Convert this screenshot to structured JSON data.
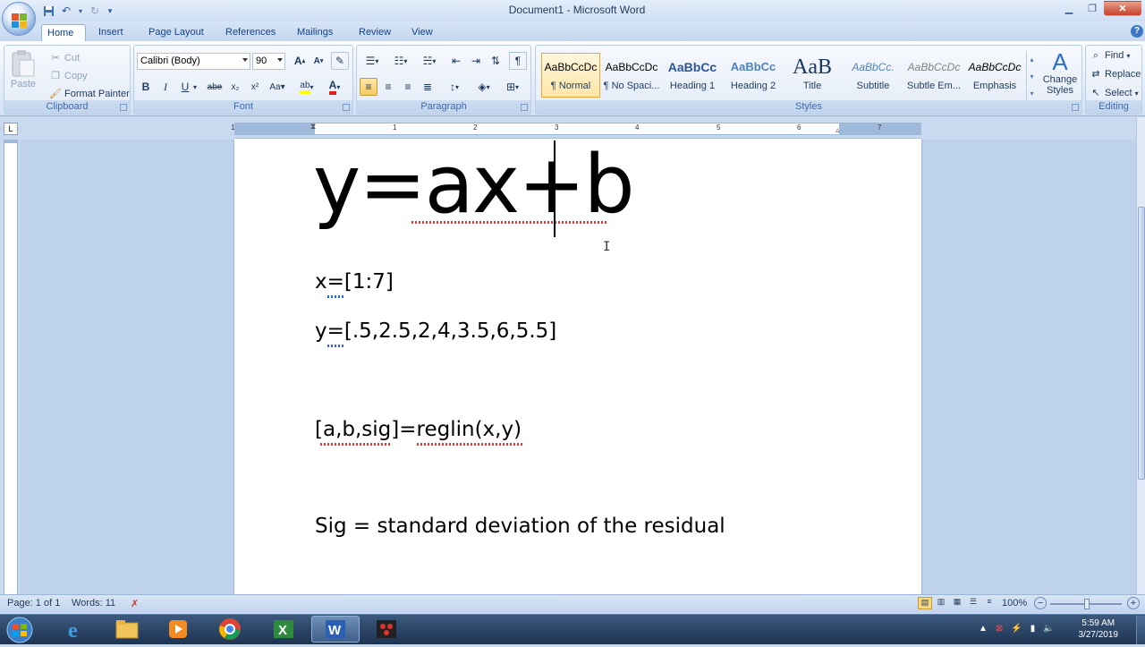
{
  "window": {
    "title": "Document1 - Microsoft Word"
  },
  "tabs": [
    "Home",
    "Insert",
    "Page Layout",
    "References",
    "Mailings",
    "Review",
    "View"
  ],
  "clipboard": {
    "paste": "Paste",
    "cut": "Cut",
    "copy": "Copy",
    "format_painter": "Format Painter",
    "group": "Clipboard"
  },
  "font": {
    "name": "Calibri (Body)",
    "size": "90",
    "group": "Font"
  },
  "paragraph": {
    "group": "Paragraph"
  },
  "styles": {
    "group": "Styles",
    "items": [
      {
        "preview": "AaBbCcDc",
        "name": "¶ Normal"
      },
      {
        "preview": "AaBbCcDc",
        "name": "¶ No Spaci..."
      },
      {
        "preview": "AaBbCc",
        "name": "Heading 1"
      },
      {
        "preview": "AaBbCc",
        "name": "Heading 2"
      },
      {
        "preview": "AaB",
        "name": "Title"
      },
      {
        "preview": "AaBbCc.",
        "name": "Subtitle"
      },
      {
        "preview": "AaBbCcDc",
        "name": "Subtle Em..."
      },
      {
        "preview": "AaBbCcDc",
        "name": "Emphasis"
      }
    ],
    "change_styles": "Change Styles"
  },
  "editing": {
    "group": "Editing",
    "find": "Find",
    "replace": "Replace",
    "select": "Select"
  },
  "ruler": {
    "numbers": [
      "1",
      "1",
      "2",
      "3",
      "4",
      "5",
      "6",
      "7"
    ]
  },
  "document": {
    "line1": "y=ax+b",
    "line2": "x=[1:7]",
    "line3": "y=[.5,2.5,2,4,3.5,6,5.5]",
    "line4": "[a,b,sig]=reglin(x,y)",
    "line5": "Sig = standard deviation of the residual"
  },
  "status": {
    "page": "Page: 1 of 1",
    "words": "Words: 11",
    "zoom": "100%"
  },
  "clock": {
    "time": "5:59 AM",
    "date": "3/27/2019"
  },
  "colors": {
    "ribbon_text": "#15428b",
    "taskbar": "#1e3352",
    "accent": "#f8c960"
  }
}
